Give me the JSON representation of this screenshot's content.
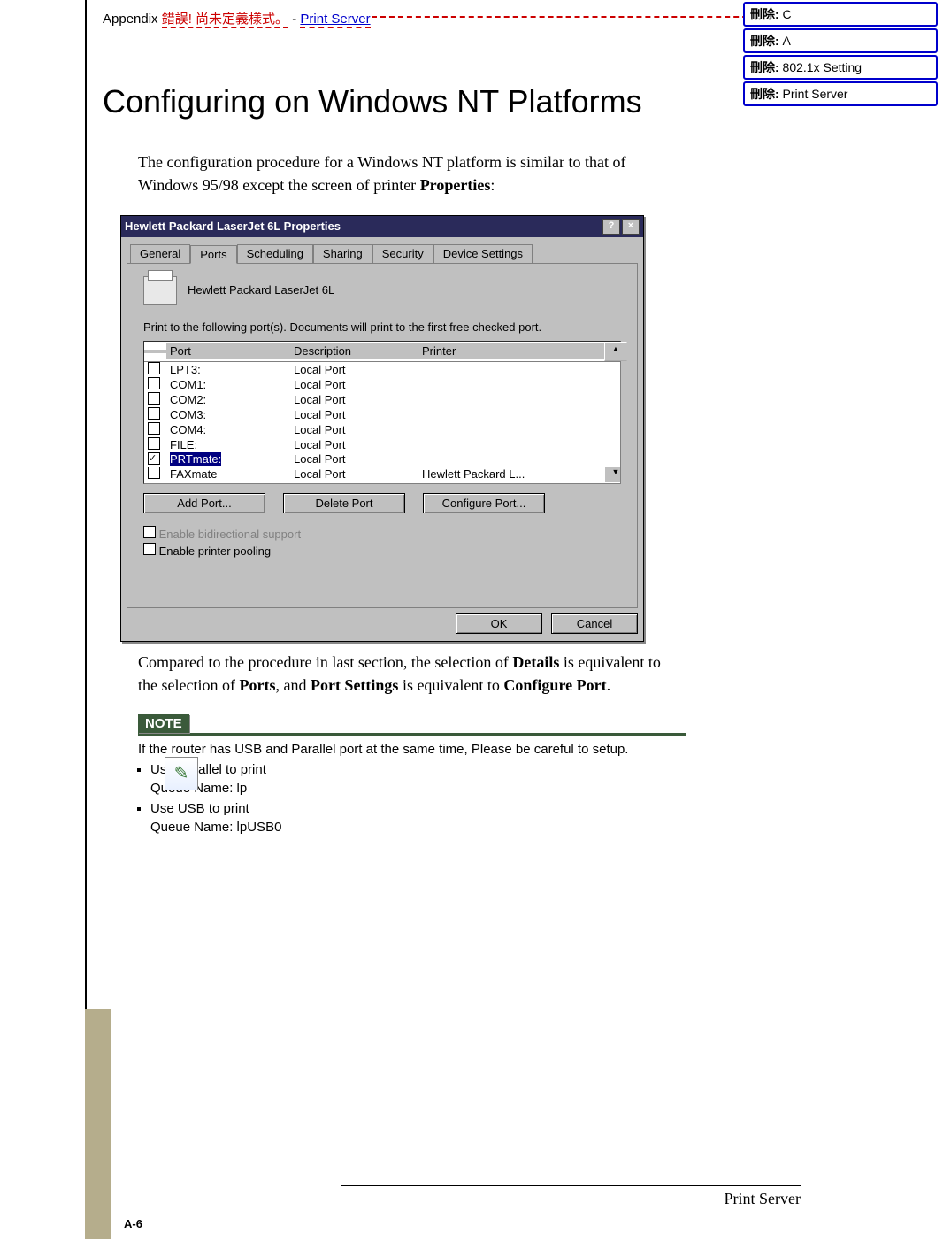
{
  "header": {
    "prefix": "Appendix ",
    "error": "錯誤! 尚未定義樣式。",
    "dash": " - ",
    "link": "Print Server"
  },
  "balloons": [
    {
      "label": "刪除:",
      "text": " C"
    },
    {
      "label": "刪除:",
      "text": " A"
    },
    {
      "label": "刪除:",
      "text": " 802.1x Setting"
    },
    {
      "label": "刪除:",
      "text": " Print Server"
    }
  ],
  "title": "Configuring on Windows NT Platforms",
  "intro": {
    "pre": "The configuration procedure for a Windows NT platform is similar to that of Windows 95/98 except the screen of printer ",
    "bold": "Properties",
    "post": ":"
  },
  "dialog": {
    "title": "Hewlett Packard LaserJet 6L Properties",
    "tabs": [
      "General",
      "Ports",
      "Scheduling",
      "Sharing",
      "Security",
      "Device Settings"
    ],
    "activeTab": 1,
    "printerName": "Hewlett Packard LaserJet 6L",
    "instruction": "Print to the following port(s).  Documents will print to the first free checked port.",
    "cols": [
      "Port",
      "Description",
      "Printer"
    ],
    "rows": [
      {
        "chk": false,
        "port": "LPT3:",
        "desc": "Local Port",
        "prn": ""
      },
      {
        "chk": false,
        "port": "COM1:",
        "desc": "Local Port",
        "prn": ""
      },
      {
        "chk": false,
        "port": "COM2:",
        "desc": "Local Port",
        "prn": ""
      },
      {
        "chk": false,
        "port": "COM3:",
        "desc": "Local Port",
        "prn": ""
      },
      {
        "chk": false,
        "port": "COM4:",
        "desc": "Local Port",
        "prn": ""
      },
      {
        "chk": false,
        "port": "FILE:",
        "desc": "Local Port",
        "prn": ""
      },
      {
        "chk": true,
        "port": "PRTmate:",
        "desc": "Local Port",
        "prn": "",
        "sel": true
      },
      {
        "chk": false,
        "port": "FAXmate",
        "desc": "Local Port",
        "prn": "Hewlett Packard L..."
      }
    ],
    "buttons": {
      "add": "Add Port...",
      "del": "Delete Port",
      "cfg": "Configure Port..."
    },
    "check1": "Enable bidirectional support",
    "check2": "Enable printer pooling",
    "ok": "OK",
    "cancel": "Cancel"
  },
  "para2": {
    "a": "Compared to the procedure in last section, the selection of ",
    "b1": "Details",
    "b": " is equivalent to the selection of ",
    "b2": "Ports",
    "c": ", and ",
    "b3": "Port Settings",
    "d": " is equivalent to ",
    "b4": "Configure Port",
    "e": "."
  },
  "note": {
    "label": "NOTE",
    "line": "If the router has USB and Parallel port at the same time, Please be careful to setup.",
    "items": [
      {
        "head": "Use Parallel to print",
        "sub": "Queue Name: lp"
      },
      {
        "head": "Use USB to print",
        "sub": "Queue Name: lpUSB0"
      }
    ]
  },
  "footer": "Print Server",
  "pagenum": "A-6"
}
